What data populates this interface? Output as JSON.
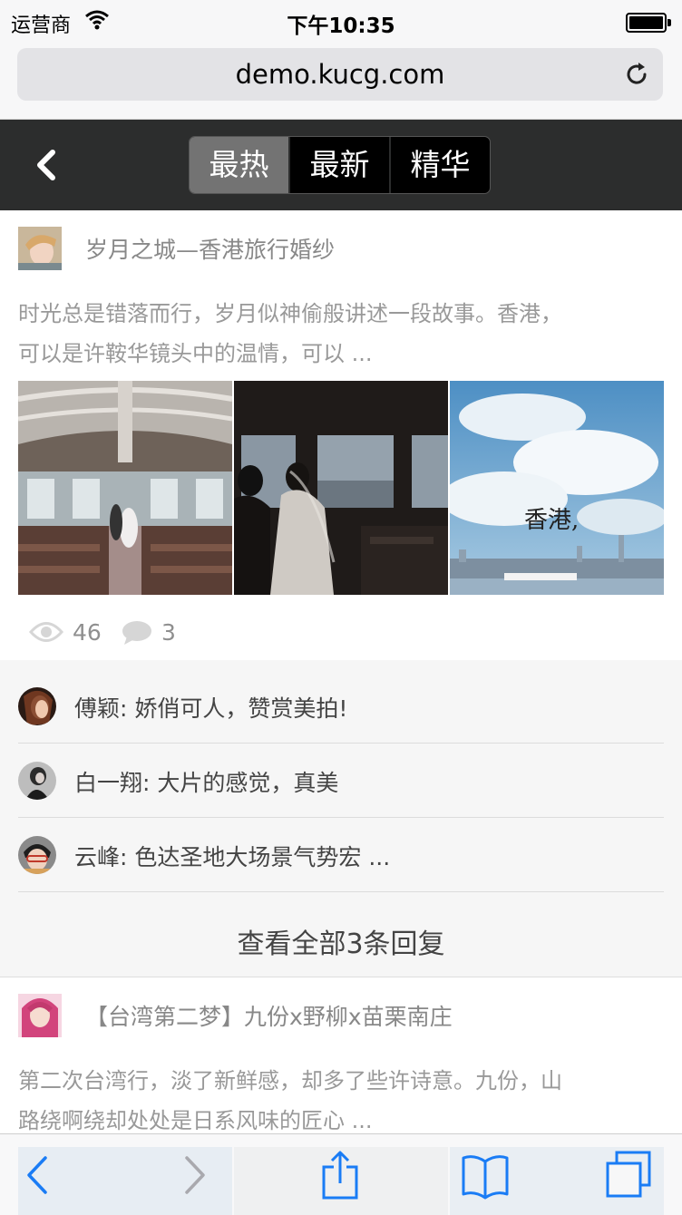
{
  "status_bar": {
    "carrier": "运营商",
    "time": "下午10:35"
  },
  "browser": {
    "url": "demo.kucg.com"
  },
  "nav": {
    "tabs": [
      {
        "label": "最热",
        "active": true
      },
      {
        "label": "最新",
        "active": false
      },
      {
        "label": "精华",
        "active": false
      }
    ]
  },
  "posts": [
    {
      "title": "岁月之城—香港旅行婚纱",
      "body_line1": "时光总是错落而行，岁月似神偷般讲述一段故事。香港，",
      "body_line2": "可以是许鞍华镜头中的温情，可以 ...",
      "photo3_caption": "香港,",
      "views": "46",
      "comment_count": "3",
      "comments": [
        {
          "text": "傅颖: 娇俏可人，赞赏美拍!"
        },
        {
          "text": "白一翔: 大片的感觉，真美"
        },
        {
          "text": "云峰: 色达圣地大场景气势宏 ..."
        }
      ],
      "view_all": "查看全部3条回复"
    },
    {
      "title": "【台湾第二梦】九份x野柳x苗栗南庄",
      "body_line1": "第二次台湾行，淡了新鲜感，却多了些许诗意。九份，山",
      "body_line2": "路绕啊绕却处处是日系风味的匠心 ..."
    }
  ],
  "colors": {
    "nav_bg": "#2c2d2d",
    "tab_active": "#737373",
    "toolbar_icon": "#1a7cf5"
  },
  "icons": {
    "wifi": "wifi-icon",
    "battery": "battery-icon",
    "reload": "reload-icon",
    "nav_back": "chevron-left-icon",
    "views": "eye-icon",
    "comments": "speech-bubble-icon",
    "toolbar_back": "back-arrow-icon",
    "toolbar_forward": "forward-arrow-icon",
    "share": "share-icon",
    "bookmarks": "bookmarks-icon",
    "tabs": "tabs-icon"
  }
}
